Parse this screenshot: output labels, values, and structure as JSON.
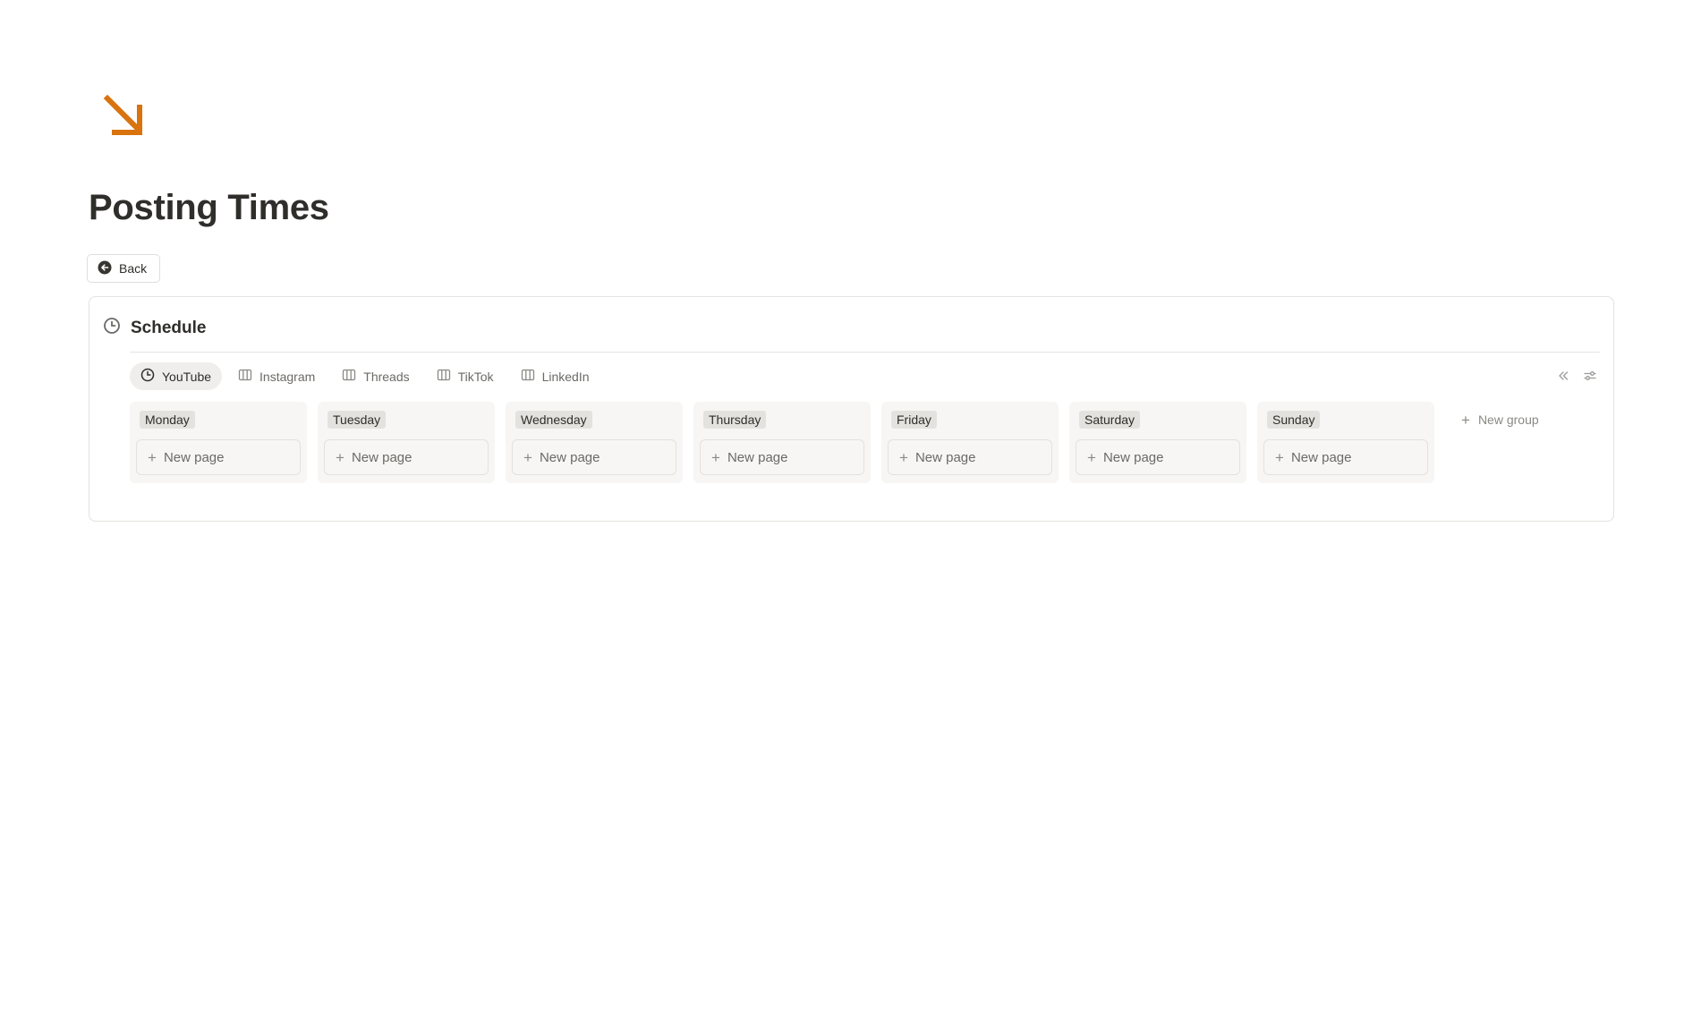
{
  "page": {
    "title": "Posting Times",
    "icon": "arrow-down-right-icon",
    "accent_color": "#d9730d"
  },
  "back_button": {
    "label": "Back",
    "icon": "arrow-left-circle-icon"
  },
  "database": {
    "title": "Schedule",
    "icon": "clock-icon",
    "tabs": [
      {
        "label": "YouTube",
        "icon": "clock-icon",
        "active": true
      },
      {
        "label": "Instagram",
        "icon": "board-icon",
        "active": false
      },
      {
        "label": "Threads",
        "icon": "board-icon",
        "active": false
      },
      {
        "label": "TikTok",
        "icon": "board-icon",
        "active": false
      },
      {
        "label": "LinkedIn",
        "icon": "board-icon",
        "active": false
      }
    ],
    "toolbar": {
      "collapse_icon": "double-chevron-left-icon",
      "settings_icon": "sliders-icon"
    },
    "columns": [
      {
        "label": "Monday",
        "new_page": "New page"
      },
      {
        "label": "Tuesday",
        "new_page": "New page"
      },
      {
        "label": "Wednesday",
        "new_page": "New page"
      },
      {
        "label": "Thursday",
        "new_page": "New page"
      },
      {
        "label": "Friday",
        "new_page": "New page"
      },
      {
        "label": "Saturday",
        "new_page": "New page"
      },
      {
        "label": "Sunday",
        "new_page": "New page"
      }
    ],
    "new_group": "New group"
  }
}
